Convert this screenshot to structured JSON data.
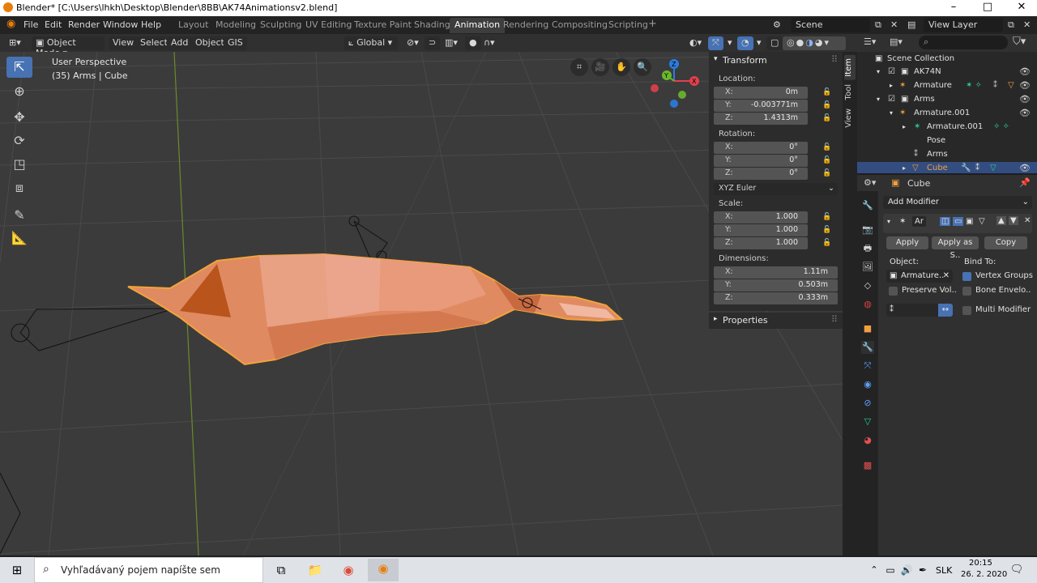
{
  "window": {
    "title": "Blender* [C:\\Users\\lhkh\\Desktop\\Blender\\8BB\\AK74Animationsv2.blend]",
    "minimize": "–",
    "maximize": "□",
    "close": "✕"
  },
  "menu": [
    "File",
    "Edit",
    "Render",
    "Window",
    "Help"
  ],
  "workspaces": [
    "Layout",
    "Modeling",
    "Sculpting",
    "UV Editing",
    "Texture Paint",
    "Shading",
    "Animation",
    "Rendering",
    "Compositing",
    "Scripting"
  ],
  "active_workspace": "Animation",
  "add_workspace": "+",
  "scene": "Scene",
  "view_layer": "View Layer",
  "header": {
    "mode": "Object Mode",
    "view": "View",
    "select": "Select",
    "add": "Add",
    "object": "Object",
    "gis": "GIS",
    "orientation": "Global"
  },
  "overlay": {
    "view_name": "User Perspective",
    "context": "(35) Arms | Cube"
  },
  "gizmo": {
    "x": "X",
    "y": "Y",
    "z": "Z"
  },
  "tool_icons": [
    "cursor-select-icon",
    "3d-cursor-icon",
    "move-icon",
    "rotate-icon",
    "scale-icon",
    "transform-icon",
    "annotate-icon",
    "measure-icon"
  ],
  "npanel": {
    "title": "Transform",
    "location_label": "Location:",
    "location": [
      {
        "axis": "X:",
        "value": "0m"
      },
      {
        "axis": "Y:",
        "value": "-0.003771m"
      },
      {
        "axis": "Z:",
        "value": "1.4313m"
      }
    ],
    "rotation_label": "Rotation:",
    "rotation": [
      {
        "axis": "X:",
        "value": "0°"
      },
      {
        "axis": "Y:",
        "value": "0°"
      },
      {
        "axis": "Z:",
        "value": "0°"
      }
    ],
    "rotation_mode": "XYZ Euler",
    "scale_label": "Scale:",
    "scale": [
      {
        "axis": "X:",
        "value": "1.000"
      },
      {
        "axis": "Y:",
        "value": "1.000"
      },
      {
        "axis": "Z:",
        "value": "1.000"
      }
    ],
    "dimensions_label": "Dimensions:",
    "dimensions": [
      {
        "axis": "X:",
        "value": "1.11m"
      },
      {
        "axis": "Y:",
        "value": "0.503m"
      },
      {
        "axis": "Z:",
        "value": "0.333m"
      }
    ],
    "properties": "Properties"
  },
  "sidebar_tabs": [
    "Item",
    "Tool",
    "View"
  ],
  "outliner": {
    "root": "Scene Collection",
    "rows": [
      {
        "label": "AK74N",
        "indent": 1
      },
      {
        "label": "Armature",
        "indent": 2
      },
      {
        "label": "Arms",
        "indent": 1
      },
      {
        "label": "Armature.001",
        "indent": 2
      },
      {
        "label": "Armature.001",
        "indent": 3
      },
      {
        "label": "Pose",
        "indent": 3
      },
      {
        "label": "Arms",
        "indent": 3
      },
      {
        "label": "Cube",
        "indent": 2
      }
    ]
  },
  "properties": {
    "object_name": "Cube",
    "add_modifier": "Add Modifier",
    "modifier_short": "Ar",
    "apply": "Apply",
    "apply_as_shape": "Apply as S..",
    "copy": "Copy",
    "object_label": "Object:",
    "object_value": "Armature..",
    "bind_to": "Bind To:",
    "vertex_groups": "Vertex Groups",
    "preserve_volume": "Preserve Vol..",
    "bone_envelopes": "Bone Envelo..",
    "multi_modifier": "Multi Modifier"
  },
  "taskbar": {
    "search_placeholder": "Vyhľadávaný pojem napíšte sem",
    "language": "SLK",
    "time": "20:15",
    "date": "26. 2. 2020"
  },
  "colors": {
    "accent": "#4772b3",
    "mesh": "#e08a62",
    "mesh_outline": "#f3a33a",
    "viewport": "#3b3b3b"
  }
}
